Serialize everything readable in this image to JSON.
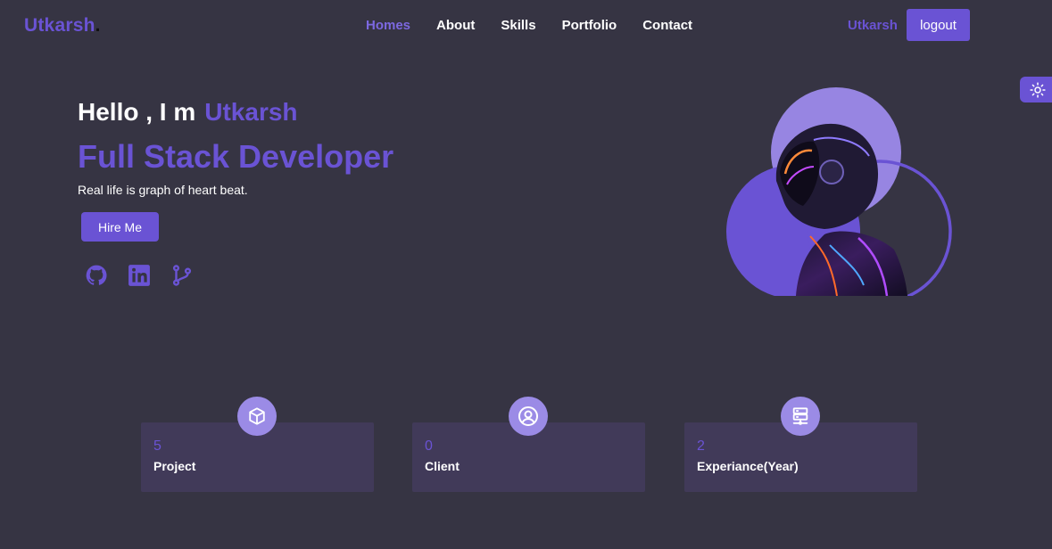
{
  "brand": {
    "name": "Utkarsh",
    "dot": "."
  },
  "nav": {
    "items": [
      {
        "label": "Homes",
        "active": true
      },
      {
        "label": "About"
      },
      {
        "label": "Skills"
      },
      {
        "label": "Portfolio"
      },
      {
        "label": "Contact"
      }
    ]
  },
  "header": {
    "user_name": "Utkarsh",
    "logout_label": "logout"
  },
  "theme_toggle": {
    "icon": "sun-icon"
  },
  "hero": {
    "greeting": "Hello , I m",
    "name": "Utkarsh",
    "role": "Full Stack Developer",
    "tagline": "Real life is graph of heart beat.",
    "cta_label": "Hire Me",
    "socials": [
      {
        "icon": "github-icon"
      },
      {
        "icon": "linkedin-icon"
      },
      {
        "icon": "git-branch-icon"
      }
    ]
  },
  "stats": [
    {
      "icon": "cube-icon",
      "count": "5",
      "label": "Project"
    },
    {
      "icon": "user-circle-icon",
      "count": "0",
      "label": "Client"
    },
    {
      "icon": "server-icon",
      "count": "2",
      "label": "Experiance(Year)"
    }
  ],
  "colors": {
    "background": "#363443",
    "accent": "#6a53d4",
    "accent_light": "#9b8be6",
    "card": "#413a59"
  }
}
